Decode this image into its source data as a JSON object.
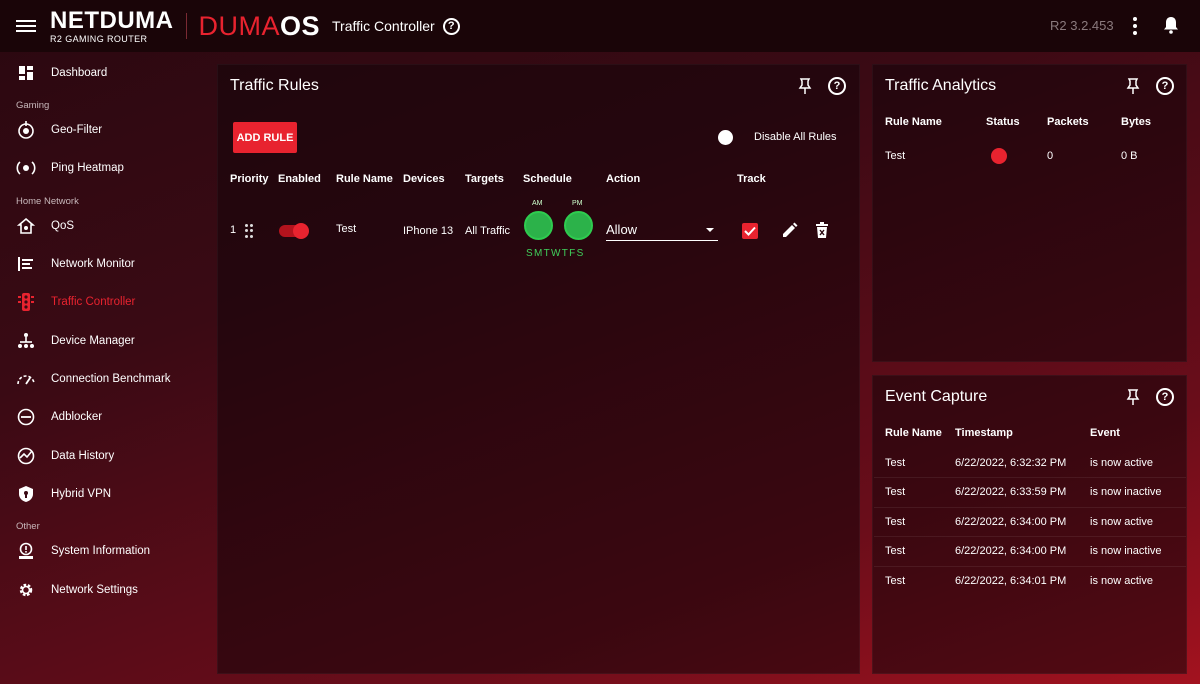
{
  "header": {
    "brand": "NETDUMA",
    "brand_sub": "R2 GAMING ROUTER",
    "duma": "DUMA",
    "os": "OS",
    "page_title": "Traffic Controller",
    "version": "R2 3.2.453"
  },
  "sidebar": {
    "items": [
      {
        "label": "Dashboard",
        "icon": "dashboard-icon"
      },
      {
        "label": "Geo-Filter",
        "icon": "geo-filter-icon"
      },
      {
        "label": "Ping Heatmap",
        "icon": "ping-heatmap-icon"
      },
      {
        "label": "QoS",
        "icon": "qos-icon"
      },
      {
        "label": "Network Monitor",
        "icon": "network-monitor-icon"
      },
      {
        "label": "Traffic Controller",
        "icon": "traffic-controller-icon"
      },
      {
        "label": "Device Manager",
        "icon": "device-manager-icon"
      },
      {
        "label": "Connection Benchmark",
        "icon": "benchmark-icon"
      },
      {
        "label": "Adblocker",
        "icon": "adblocker-icon"
      },
      {
        "label": "Data History",
        "icon": "data-history-icon"
      },
      {
        "label": "Hybrid VPN",
        "icon": "vpn-shield-icon"
      },
      {
        "label": "System Information",
        "icon": "system-info-icon"
      },
      {
        "label": "Network Settings",
        "icon": "gear-icon"
      }
    ],
    "sections": {
      "gaming": "Gaming",
      "home_network": "Home Network",
      "other": "Other"
    },
    "active": "Traffic Controller"
  },
  "traffic_rules": {
    "title": "Traffic Rules",
    "add_rule": "ADD RULE",
    "disable_all": "Disable All Rules",
    "columns": [
      "Priority",
      "Enabled",
      "Rule Name",
      "Devices",
      "Targets",
      "Schedule",
      "Action",
      "Track"
    ],
    "row": {
      "priority": "1",
      "rule_name": "Test",
      "devices": "IPhone 13",
      "targets": "All Traffic",
      "am": "AM",
      "pm": "PM",
      "days": "SMTWTFS",
      "action": "Allow"
    }
  },
  "traffic_analytics": {
    "title": "Traffic Analytics",
    "columns": [
      "Rule Name",
      "Status",
      "Packets",
      "Bytes"
    ],
    "row": {
      "rule_name": "Test",
      "packets": "0",
      "bytes": "0 B"
    }
  },
  "event_capture": {
    "title": "Event Capture",
    "columns": [
      "Rule Name",
      "Timestamp",
      "Event"
    ],
    "rows": [
      {
        "rule": "Test",
        "ts": "6/22/2022, 6:32:32 PM",
        "event": "is now active"
      },
      {
        "rule": "Test",
        "ts": "6/22/2022, 6:33:59 PM",
        "event": "is now inactive"
      },
      {
        "rule": "Test",
        "ts": "6/22/2022, 6:34:00 PM",
        "event": "is now active"
      },
      {
        "rule": "Test",
        "ts": "6/22/2022, 6:34:00 PM",
        "event": "is now inactive"
      },
      {
        "rule": "Test",
        "ts": "6/22/2022, 6:34:01 PM",
        "event": "is now active"
      }
    ]
  },
  "colors": {
    "accent": "#e8232f",
    "schedule_green": "#2ecc4f"
  }
}
